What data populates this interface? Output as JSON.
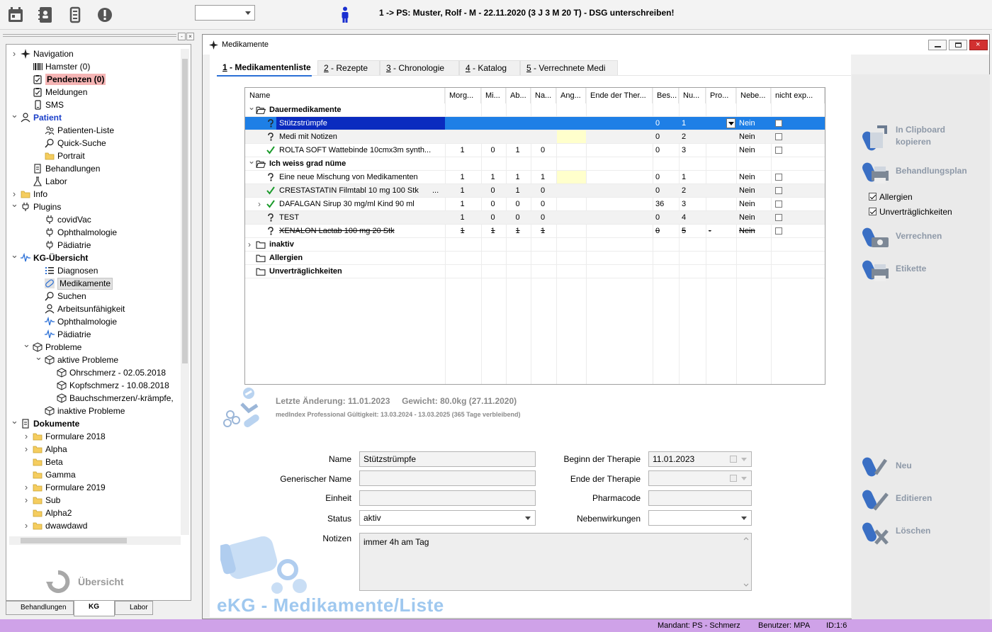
{
  "header": {
    "patient_select_value": "",
    "patient_info": "1 -> PS: Muster, Rolf - M - 22.11.2020 (3 J 3 M 20 T) - DSG unterschreiben!"
  },
  "nav": {
    "items": [
      {
        "label": "Navigation",
        "icon": "compass-icon"
      },
      {
        "label": "Hamster (0)",
        "icon": "barcode-icon"
      },
      {
        "label": "Pendenzen (0)",
        "icon": "clipboard-icon"
      },
      {
        "label": "Meldungen",
        "icon": "clipboard-icon"
      },
      {
        "label": "SMS",
        "icon": "phone-icon"
      },
      {
        "label": "Patient",
        "icon": "person-icon"
      },
      {
        "label": "Patienten-Liste",
        "icon": "people-icon"
      },
      {
        "label": "Quick-Suche",
        "icon": "search-icon"
      },
      {
        "label": "Portrait",
        "icon": "folder-icon"
      },
      {
        "label": "Behandlungen",
        "icon": "document-icon"
      },
      {
        "label": "Labor",
        "icon": "flask-icon"
      },
      {
        "label": "Info",
        "icon": "folder-icon"
      },
      {
        "label": "Plugins",
        "icon": "plug-icon"
      },
      {
        "label": "covidVac",
        "icon": "plug-icon"
      },
      {
        "label": "Ophthalmologie",
        "icon": "plug-icon"
      },
      {
        "label": "Pädiatrie",
        "icon": "plug-icon"
      },
      {
        "label": "KG-Übersicht",
        "icon": "pulse-icon"
      },
      {
        "label": "Diagnosen",
        "icon": "list-icon"
      },
      {
        "label": "Medikamente",
        "icon": "pill-icon"
      },
      {
        "label": "Suchen",
        "icon": "search-icon"
      },
      {
        "label": "Arbeitsunfähigkeit",
        "icon": "person-icon"
      },
      {
        "label": "Ophthalmologie",
        "icon": "pulse-icon"
      },
      {
        "label": "Pädiatrie",
        "icon": "pulse-icon"
      },
      {
        "label": "Probleme",
        "icon": "cube-icon"
      },
      {
        "label": "aktive Probleme",
        "icon": "cube-icon"
      },
      {
        "label": "Ohrschmerz - 02.05.2018",
        "icon": "cube-icon"
      },
      {
        "label": "Kopfschmerz - 10.08.2018",
        "icon": "cube-icon"
      },
      {
        "label": "Bauchschmerzen/-krämpfe,",
        "icon": "cube-icon"
      },
      {
        "label": "inaktive Probleme",
        "icon": "cube-icon"
      },
      {
        "label": "Dokumente",
        "icon": "document-icon"
      },
      {
        "label": "Formulare 2018",
        "icon": "folder-icon"
      },
      {
        "label": "Alpha",
        "icon": "folder-icon"
      },
      {
        "label": "Beta",
        "icon": "folder-icon"
      },
      {
        "label": "Gamma",
        "icon": "folder-icon"
      },
      {
        "label": "Formulare 2019",
        "icon": "folder-icon"
      },
      {
        "label": "Sub",
        "icon": "folder-icon"
      },
      {
        "label": "Alpha2",
        "icon": "folder-icon"
      },
      {
        "label": "dwawdawd",
        "icon": "folder-icon"
      }
    ],
    "uebersicht_label": "Übersicht",
    "tabs": [
      "Behandlungen",
      "KG",
      "Labor"
    ]
  },
  "window": {
    "title": "Medikamente",
    "tabs": [
      {
        "num": "1",
        "label": " - Medikamentenliste"
      },
      {
        "num": "2",
        "label": " - Rezepte"
      },
      {
        "num": "3",
        "label": " - Chronologie"
      },
      {
        "num": "4",
        "label": " - Katalog"
      },
      {
        "num": "5",
        "label": " - Verrechnete Medi"
      }
    ]
  },
  "grid": {
    "columns": [
      "Name",
      "Morg...",
      "Mi...",
      "Ab...",
      "Na...",
      "Ang...",
      "Ende der Ther...",
      "Bes...",
      "Nu...",
      "Pro...",
      "Nebe...",
      "nicht exp..."
    ],
    "rows": [
      {
        "kind": "group",
        "name": "Dauermedikamente"
      },
      {
        "kind": "item",
        "status": "unknown",
        "name": "Stützstrümpfe",
        "morg": "",
        "mi": "",
        "ab": "",
        "na": "",
        "bes": "0",
        "nu": "1",
        "neb": "Nein",
        "selected": true
      },
      {
        "kind": "item",
        "status": "unknown",
        "name": "Medi mit Notizen",
        "morg": "",
        "mi": "",
        "ab": "",
        "na": "",
        "bes": "0",
        "nu": "2",
        "neb": "Nein",
        "yellow": true
      },
      {
        "kind": "item",
        "status": "ok",
        "name": "ROLTA SOFT Wattebinde 10cmx3m synth...",
        "morg": "1",
        "mi": "0",
        "ab": "1",
        "na": "0",
        "bes": "0",
        "nu": "3",
        "neb": "Nein"
      },
      {
        "kind": "group",
        "name": "Ich weiss grad nüme"
      },
      {
        "kind": "item",
        "status": "unknown",
        "name": "Eine neue Mischung von Medikamenten",
        "morg": "1",
        "mi": "1",
        "ab": "1",
        "na": "1",
        "bes": "0",
        "nu": "1",
        "neb": "Nein",
        "yellow": true
      },
      {
        "kind": "item",
        "status": "ok",
        "name": "CRESTASTATIN Filmtabl 10 mg 100 Stk",
        "name_suffix": "...",
        "morg": "1",
        "mi": "0",
        "ab": "1",
        "na": "0",
        "bes": "0",
        "nu": "2",
        "neb": "Nein"
      },
      {
        "kind": "item",
        "status": "ok",
        "name": "DAFALGAN Sirup 30 mg/ml Kind 90 ml",
        "morg": "1",
        "mi": "0",
        "ab": "0",
        "na": "0",
        "bes": "36",
        "nu": "3",
        "neb": "Nein",
        "expander": true
      },
      {
        "kind": "item",
        "status": "unknown",
        "name": "TEST",
        "morg": "1",
        "mi": "0",
        "ab": "0",
        "na": "0",
        "bes": "0",
        "nu": "4",
        "neb": "Nein"
      },
      {
        "kind": "item",
        "status": "unknown",
        "name": "XENALON Lactab 100 mg 20 Stk",
        "morg": "1",
        "mi": "1",
        "ab": "1",
        "na": "1",
        "bes": "0",
        "nu": "5",
        "pro": "-",
        "neb": "Nein",
        "strike": true
      },
      {
        "kind": "group",
        "name": "inaktiv",
        "expander": true
      },
      {
        "kind": "group",
        "name": "Allergien"
      },
      {
        "kind": "group",
        "name": "Unverträglichkeiten"
      }
    ]
  },
  "info": {
    "last_change": "Letzte Änderung: 11.01.2023",
    "weight": "Gewicht: 80.0kg (27.11.2020)",
    "medindex": "medIndex Professional Gültigkeit: 13.03.2024 - 13.03.2025 (365 Tage verbleibend)"
  },
  "form": {
    "name_label": "Name",
    "name_value": "Stützstrümpfe",
    "generic_label": "Generischer Name",
    "generic_value": "",
    "unit_label": "Einheit",
    "unit_value": "",
    "status_label": "Status",
    "status_value": "aktiv",
    "notes_label": "Notizen",
    "notes_value": "immer 4h am Tag",
    "start_label": "Beginn der Therapie",
    "start_value": "11.01.2023",
    "end_label": "Ende der Therapie",
    "end_value": "",
    "pharmacode_label": "Pharmacode",
    "pharmacode_value": "",
    "side_label": "Nebenwirkungen",
    "side_value": ""
  },
  "brand_title": "eKG - Medikamente/Liste",
  "actions": {
    "clipboard": "In Clipboard kopieren",
    "plan": "Behandlungsplan",
    "allergies": "Allergien",
    "intolerances": "Unverträglichkeiten",
    "billing": "Verrechnen",
    "label": "Etikette",
    "new": "Neu",
    "edit": "Editieren",
    "delete": "Löschen"
  },
  "status": {
    "mandant": "Mandant: PS - Schmerz",
    "user": "Benutzer: MPA",
    "id": "ID:1:6"
  },
  "colors": {
    "selection": "#1e7fe6",
    "highlight": "#f5b4b4",
    "statusbar": "#cfa2e8",
    "action_label": "#8e99a8"
  }
}
